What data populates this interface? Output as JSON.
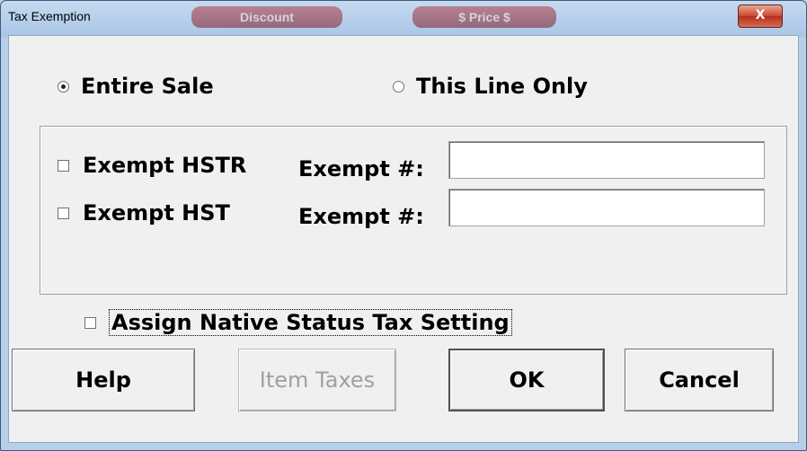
{
  "window": {
    "title": "Tax Exemption",
    "close_glyph": "X",
    "background_buttons": [
      "Discount",
      "$ Price $"
    ]
  },
  "scope": {
    "options": [
      {
        "label": "Entire Sale",
        "selected": true
      },
      {
        "label": "This Line Only",
        "selected": false
      }
    ]
  },
  "exemptions": [
    {
      "checkbox_label": "Exempt HSTR",
      "checked": false,
      "field_label": "Exempt #:",
      "value": ""
    },
    {
      "checkbox_label": "Exempt HST",
      "checked": false,
      "field_label": "Exempt #:",
      "value": ""
    }
  ],
  "native_status": {
    "label": "Assign Native Status Tax Setting",
    "checked": false
  },
  "buttons": {
    "help": "Help",
    "item_taxes": "Item Taxes",
    "ok": "OK",
    "cancel": "Cancel"
  },
  "colors": {
    "title_bar": "#a9c6e6",
    "close_button": "#c9462f",
    "dialog_background": "#f0f0f0",
    "disabled_text": "#a0a0a0"
  },
  "icons": [
    "close-icon",
    "radio-icon",
    "checkbox-icon"
  ]
}
